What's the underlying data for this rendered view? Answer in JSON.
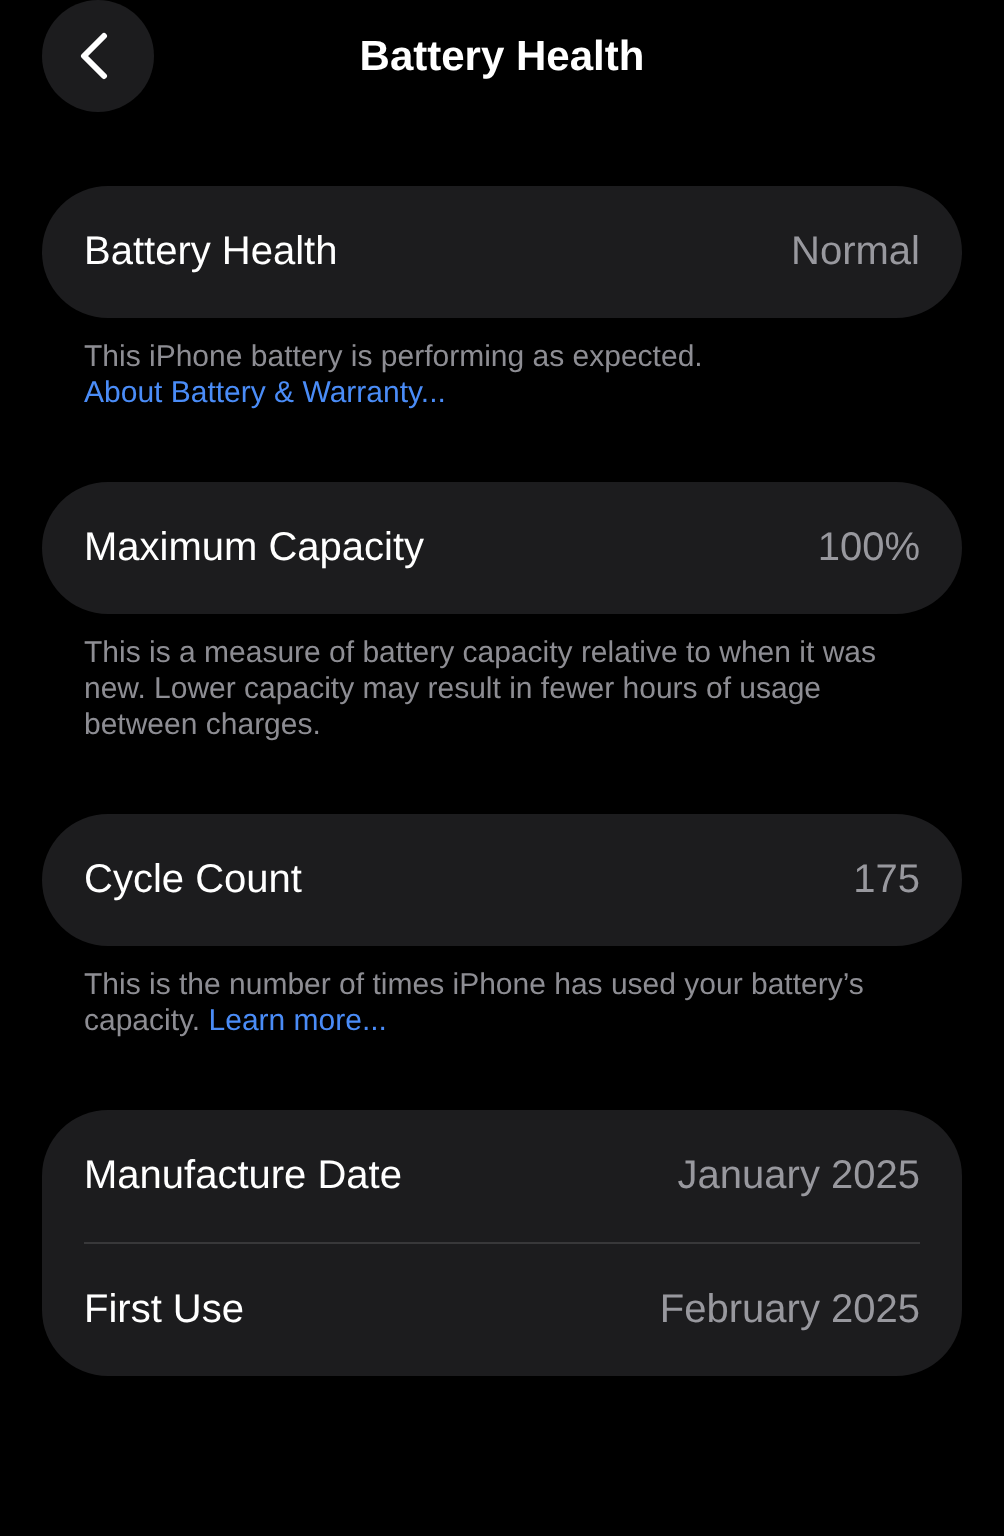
{
  "header": {
    "title": "Battery Health"
  },
  "sections": [
    {
      "rows": [
        {
          "label": "Battery Health",
          "value": "Normal"
        }
      ],
      "footnote": {
        "text": "This iPhone battery is performing as expected.",
        "link": "About Battery & Warranty..."
      }
    },
    {
      "rows": [
        {
          "label": "Maximum Capacity",
          "value": "100%"
        }
      ],
      "footnote": {
        "text": "This is a measure of battery capacity relative to when it was new. Lower capacity may result in fewer hours of usage between charges."
      }
    },
    {
      "rows": [
        {
          "label": "Cycle Count",
          "value": "175"
        }
      ],
      "footnote": {
        "text": "This is the number of times iPhone has used your battery’s capacity.",
        "link": "Learn more..."
      }
    },
    {
      "rows": [
        {
          "label": "Manufacture Date",
          "value": "January 2025"
        },
        {
          "label": "First Use",
          "value": "February 2025"
        }
      ]
    }
  ]
}
